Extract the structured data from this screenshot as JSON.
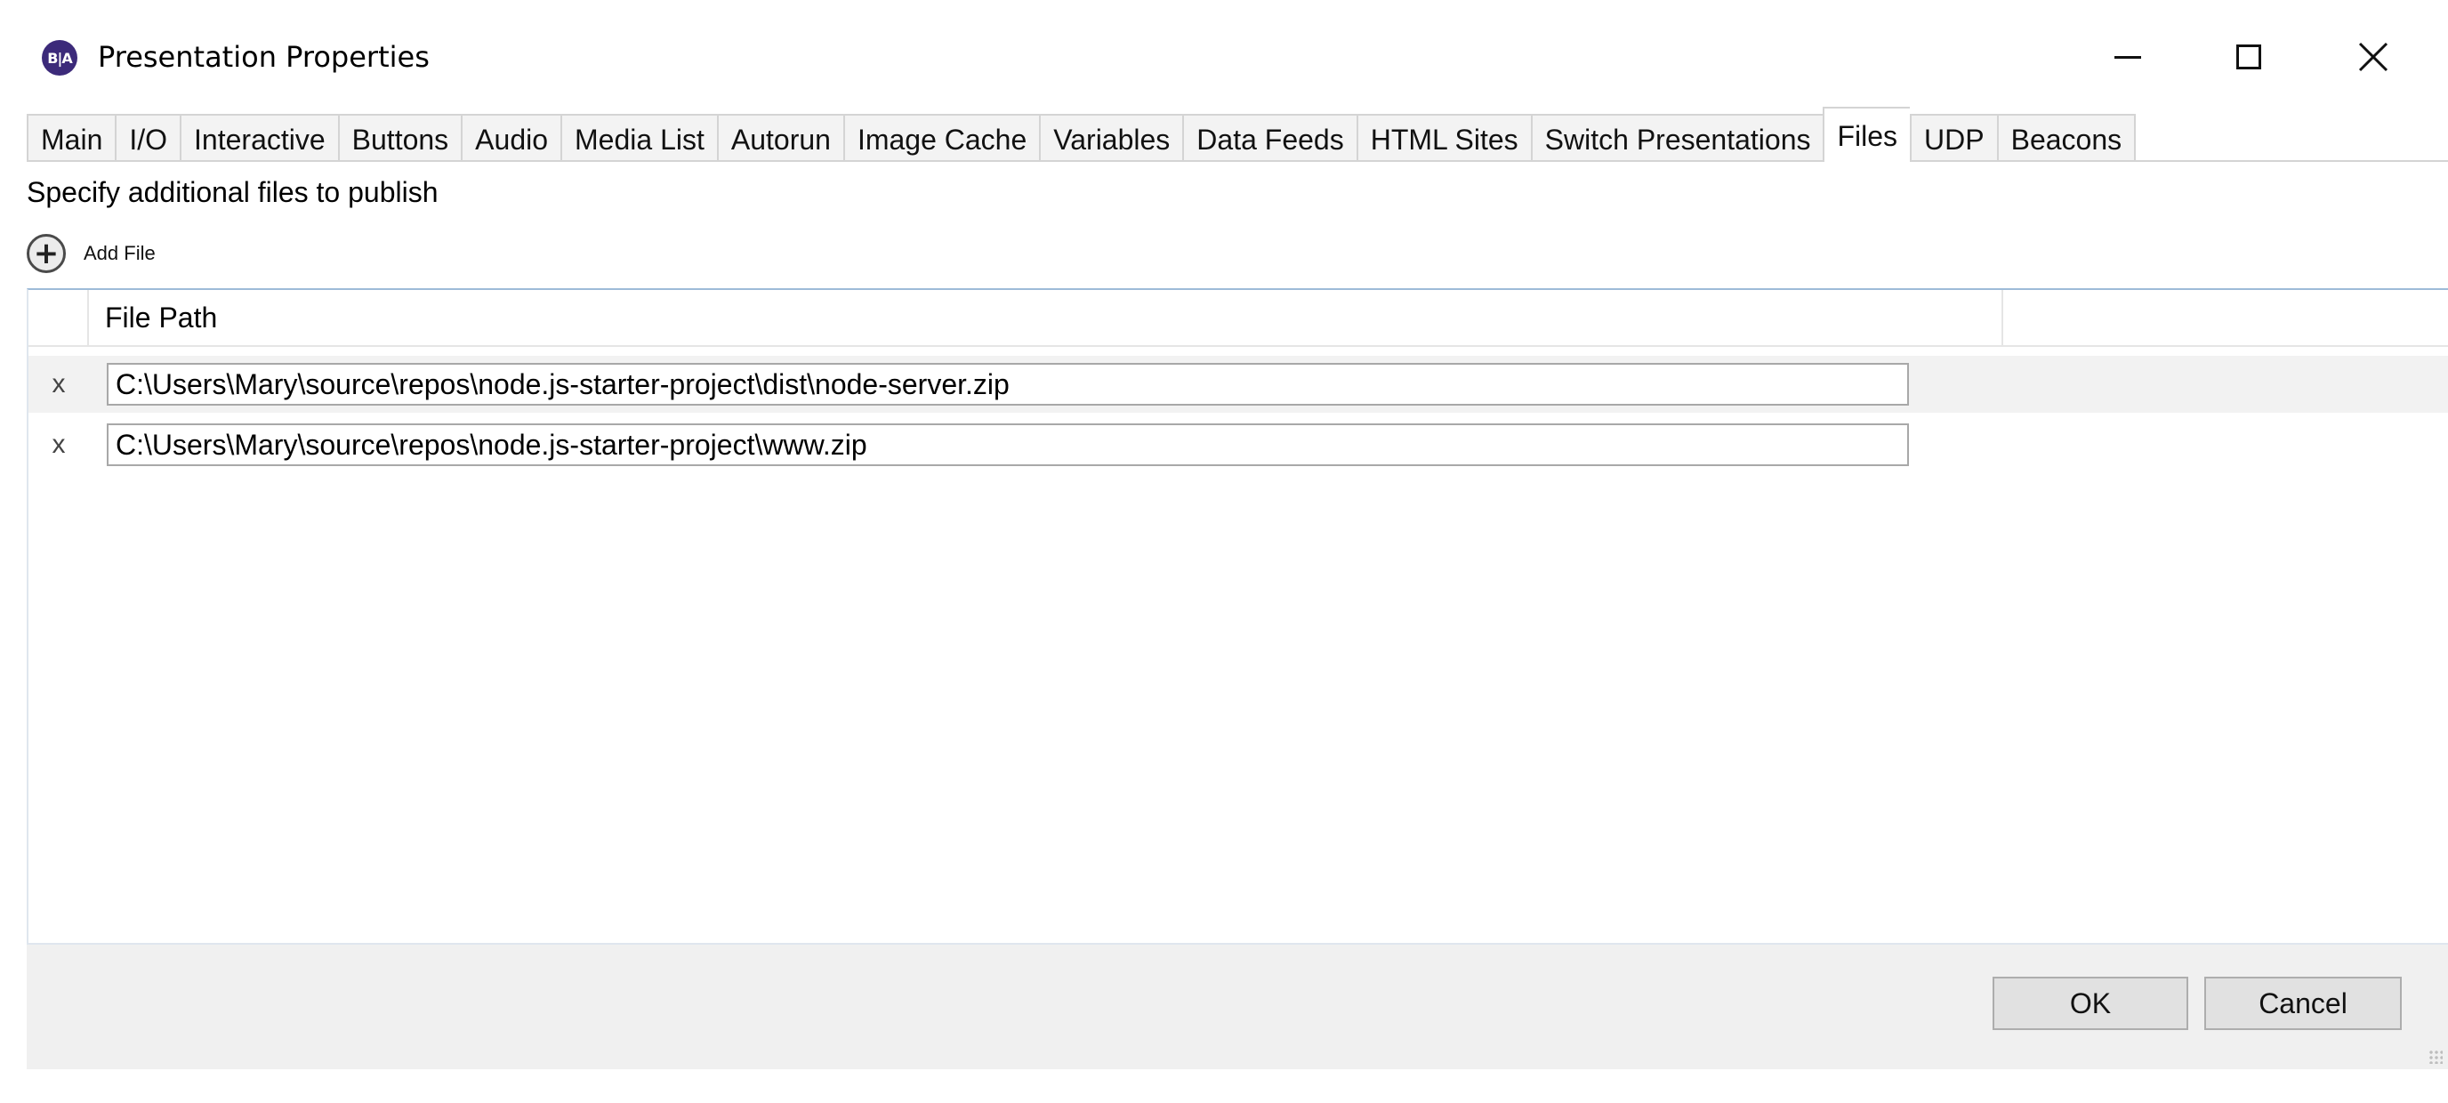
{
  "window": {
    "title": "Presentation Properties",
    "icon": "brightauthor-app-icon",
    "icon_text": "B|A",
    "controls": {
      "minimize": "minimize-icon",
      "maximize": "maximize-icon",
      "close": "close-icon"
    }
  },
  "tabs": [
    {
      "label": "Main"
    },
    {
      "label": "I/O"
    },
    {
      "label": "Interactive"
    },
    {
      "label": "Buttons"
    },
    {
      "label": "Audio"
    },
    {
      "label": "Media List"
    },
    {
      "label": "Autorun"
    },
    {
      "label": "Image Cache"
    },
    {
      "label": "Variables"
    },
    {
      "label": "Data Feeds"
    },
    {
      "label": "HTML Sites"
    },
    {
      "label": "Switch Presentations"
    },
    {
      "label": "Files",
      "active": true
    },
    {
      "label": "UDP"
    },
    {
      "label": "Beacons"
    }
  ],
  "files_tab": {
    "instructions": "Specify additional files to publish",
    "add_file_label": "Add File",
    "grid": {
      "column_header": "File Path",
      "rows": [
        {
          "remove": "x",
          "path": "C:\\Users\\Mary\\source\\repos\\node.js-starter-project\\dist\\node-server.zip"
        },
        {
          "remove": "x",
          "path": "C:\\Users\\Mary\\source\\repos\\node.js-starter-project\\www.zip"
        }
      ]
    }
  },
  "footer": {
    "ok_label": "OK",
    "cancel_label": "Cancel"
  },
  "colors": {
    "app_icon": "#3c2a7a",
    "grid_border": "#9dbbd8",
    "footer_bg": "#f0f0f0",
    "selected_row_bg": "#f2f2f2"
  }
}
